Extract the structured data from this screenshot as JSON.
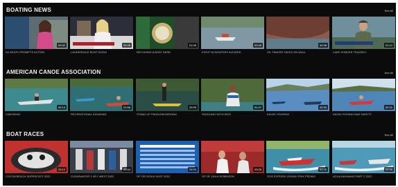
{
  "sections": [
    {
      "title": "BOATING NEWS",
      "see_all": "See All",
      "videos": [
        {
          "caption": "NJ DEATH PROMPTS ACTION",
          "duration": "00:32"
        },
        {
          "caption": "LAUDERDALE BOAT SHOW",
          "duration": "00:48"
        },
        {
          "caption": "BECOMING A BOAT NERD",
          "duration": "01:06"
        },
        {
          "caption": "EIGHT NJ BOATERS INJURED",
          "duration": "00:45"
        },
        {
          "caption": "OIL TANKER TAKES ON WALL",
          "duration": "00:38"
        },
        {
          "caption": "LAKE HONKER TRAGEDY",
          "duration": "01:12"
        }
      ]
    },
    {
      "title": "AMERICAN CANOE ASSOCIATION",
      "see_all": "See All",
      "videos": [
        {
          "caption": "CANOEING",
          "duration": "02:14"
        },
        {
          "caption": "RECREATIONAL KAYAKING",
          "duration": "01:58"
        },
        {
          "caption": "STAND UP PADDLEBOARDING",
          "duration": "02:05"
        },
        {
          "caption": "PADDLING WITH KIDS",
          "duration": "01:47"
        },
        {
          "caption": "KAYAK TOURING",
          "duration": "02:30"
        },
        {
          "caption": "KAYAK FISHING AND SAFETY",
          "duration": "02:21"
        }
      ]
    },
    {
      "title": "BOAT RACES",
      "see_all": "See All",
      "videos": [
        {
          "caption": "COCOA BEACH SUPERCATS 2022",
          "duration": "03:12"
        },
        {
          "caption": "CLEARWATER 1 KEY WEST 2022",
          "duration": "02:44"
        },
        {
          "caption": "OP OR SIOUX EAST 2022",
          "duration": "04:05"
        },
        {
          "caption": "OP OF ZAILA ROBINSON",
          "duration": "03:26"
        },
        {
          "caption": "2022 EXPERIO GRAND PRIX PROMO",
          "duration": "01:15"
        },
        {
          "caption": "AGUA BAHAMAS PART 2 2022",
          "duration": "02:58"
        }
      ]
    }
  ]
}
